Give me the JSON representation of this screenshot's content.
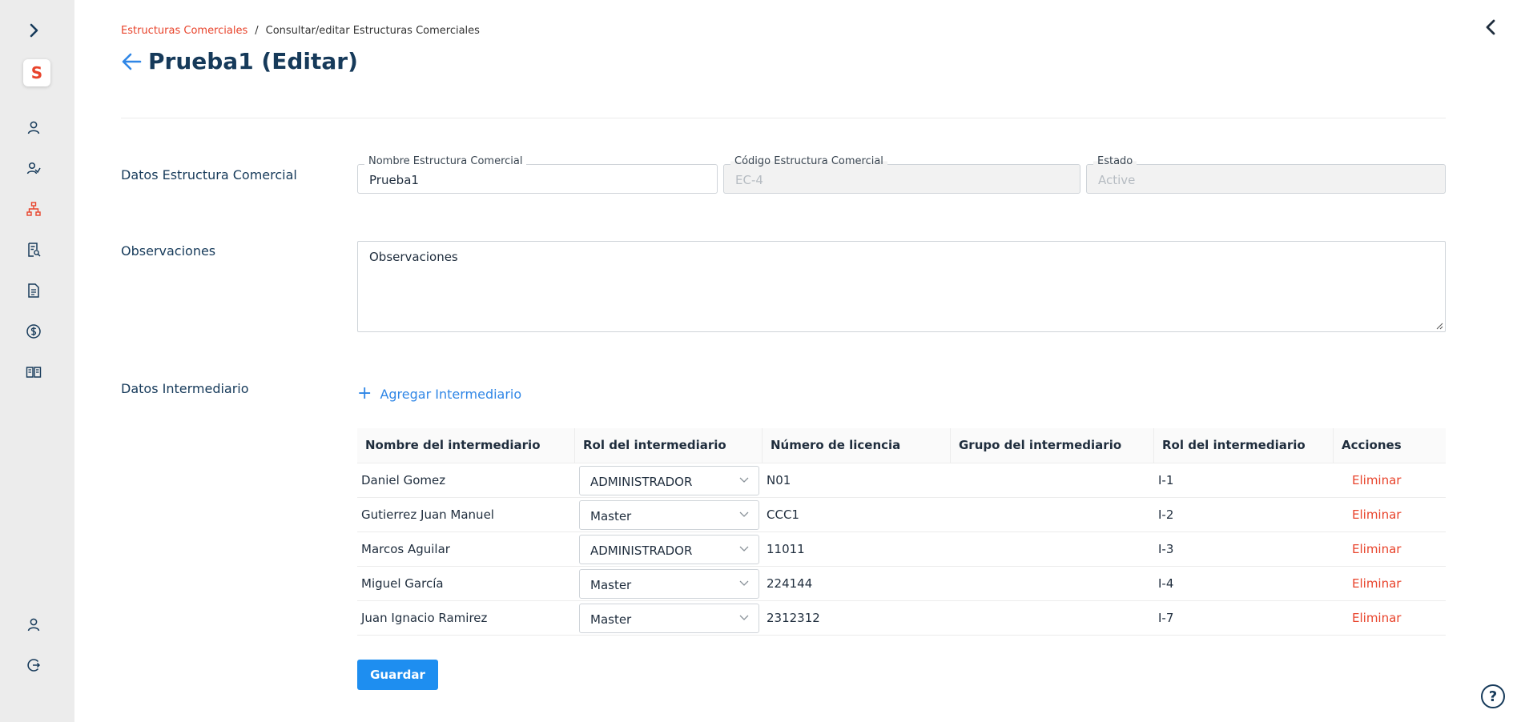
{
  "sidebar": {
    "logo_letter": "S",
    "accent": "#e8432b",
    "icons": [
      "expand-icon",
      "user-icon",
      "users-icon",
      "hierarchy-icon",
      "search-document-icon",
      "document-icon",
      "dollar-icon",
      "book-icon",
      "profile-icon",
      "logout-icon"
    ]
  },
  "breadcrumb": {
    "parent": "Estructuras Comerciales",
    "separator": "/",
    "current": "Consultar/editar Estructuras Comerciales"
  },
  "page": {
    "title": "Prueba1 (Editar)"
  },
  "section_datos": {
    "label": "Datos Estructura Comercial",
    "nombre_label": "Nombre Estructura Comercial",
    "nombre_value": "Prueba1",
    "codigo_label": "Código Estructura Comercial",
    "codigo_value": "EC-4",
    "estado_label": "Estado",
    "estado_value": "Active"
  },
  "section_obs": {
    "label": "Observaciones",
    "value": "Observaciones"
  },
  "section_intermediario": {
    "label": "Datos Intermediario",
    "add_label": "Agregar Intermediario"
  },
  "table": {
    "headers": [
      "Nombre del intermediario",
      "Rol del intermediario",
      "Número de licencia",
      "Grupo del intermediario",
      "Rol del intermediario",
      "Acciones"
    ],
    "rows": [
      {
        "name": "Daniel Gomez",
        "role": "ADMINISTRADOR",
        "license": "N01",
        "group": "",
        "code": "I-1",
        "action": "Eliminar"
      },
      {
        "name": "Gutierrez Juan Manuel",
        "role": "Master",
        "license": "CCC1",
        "group": "",
        "code": "I-2",
        "action": "Eliminar"
      },
      {
        "name": "Marcos Aguilar",
        "role": "ADMINISTRADOR",
        "license": "11011",
        "group": "",
        "code": "I-3",
        "action": "Eliminar"
      },
      {
        "name": "Miguel García",
        "role": "Master",
        "license": "224144",
        "group": "",
        "code": "I-4",
        "action": "Eliminar"
      },
      {
        "name": "Juan Ignacio Ramirez",
        "role": "Master",
        "license": "2312312",
        "group": "",
        "code": "I-7",
        "action": "Eliminar"
      }
    ]
  },
  "actions": {
    "save_label": "Guardar",
    "help_label": "?"
  },
  "colors": {
    "primary": "#1e8ef0",
    "danger": "#e8432b",
    "heading": "#163a5a"
  }
}
